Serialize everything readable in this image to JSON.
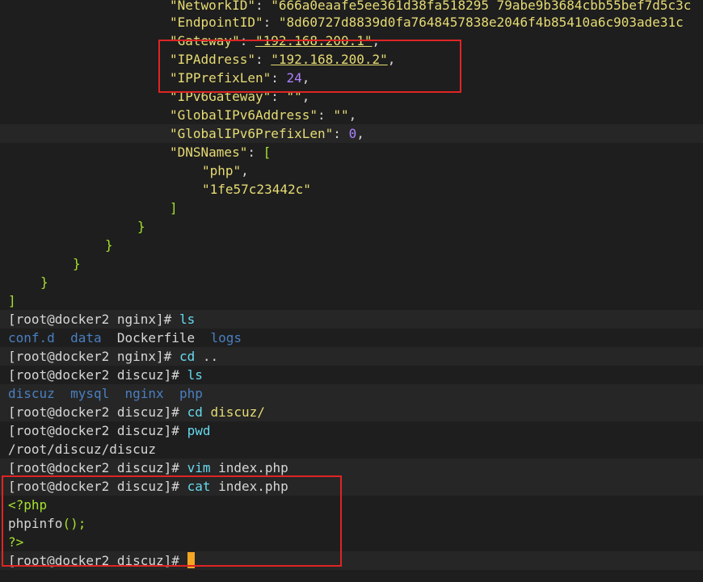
{
  "json_output": {
    "network_id_key": "\"NetworkID\"",
    "network_id_val": "\"666a0eaafe5ee361d38fa518295 79abe9b3684cbb55bef7d5c3c",
    "endpoint_id_key": "\"EndpointID\"",
    "endpoint_id_val": "\"8d60727d8839d0fa7648457838e2046f4b85410a6c903ade31c",
    "gateway_key": "\"Gateway\"",
    "gateway_val": "\"192.168.200.1\"",
    "ipaddress_key": "\"IPAddress\"",
    "ipaddress_val": "\"192.168.200.2\"",
    "ipprefixlen_key": "\"IPPrefixLen\"",
    "ipprefixlen_val": "24",
    "ipv6gateway_key": "\"IPv6Gateway\"",
    "ipv6gateway_val": "\"\"",
    "globalipv6address_key": "\"GlobalIPv6Address\"",
    "globalipv6address_val": "\"\"",
    "globalipv6prefixlen_key": "\"GlobalIPv6PrefixLen\"",
    "globalipv6prefixlen_val": "0",
    "dnsnames_key": "\"DNSNames\"",
    "dnsnames_items": [
      "\"php\"",
      "\"1fe57c23442c\""
    ],
    "colon": ":",
    "comma": ",",
    "open_bracket": "[",
    "close_bracket": "]",
    "close_brace": "}"
  },
  "session": {
    "prompt_nginx": "[root@docker2 nginx]#",
    "prompt_discuz": "[root@docker2 discuz]#",
    "cmd_ls": "ls",
    "cmd_cd_up": "cd",
    "cmd_cd_up_arg": "..",
    "cmd_cd_discuz": "cd",
    "cmd_cd_discuz_arg": "discuz/",
    "cmd_pwd": "pwd",
    "cmd_vim": "vim",
    "cmd_vim_arg": "index.php",
    "cmd_cat": "cat",
    "cmd_cat_arg": "index.php",
    "ls_nginx": {
      "dir1": "conf.d",
      "dir2": "data",
      "file1": "Dockerfile",
      "dir3": "logs"
    },
    "ls_discuz": {
      "dir1": "discuz",
      "dir2": "mysql",
      "dir3": "nginx",
      "dir4": "php"
    },
    "pwd_output": "/root/discuz/discuz",
    "php_open": "<?php",
    "php_fn": "phpinfo",
    "php_parens": "();",
    "php_close": "?>"
  },
  "colors": {
    "background": "#1e1e1e",
    "string": "#e6db74",
    "keyword": "#a6e22e",
    "number": "#ae81ff",
    "directory": "#4a7fc0",
    "command": "#66d9ef",
    "highlight_box": "#e02424",
    "cursor": "#f5a623"
  }
}
